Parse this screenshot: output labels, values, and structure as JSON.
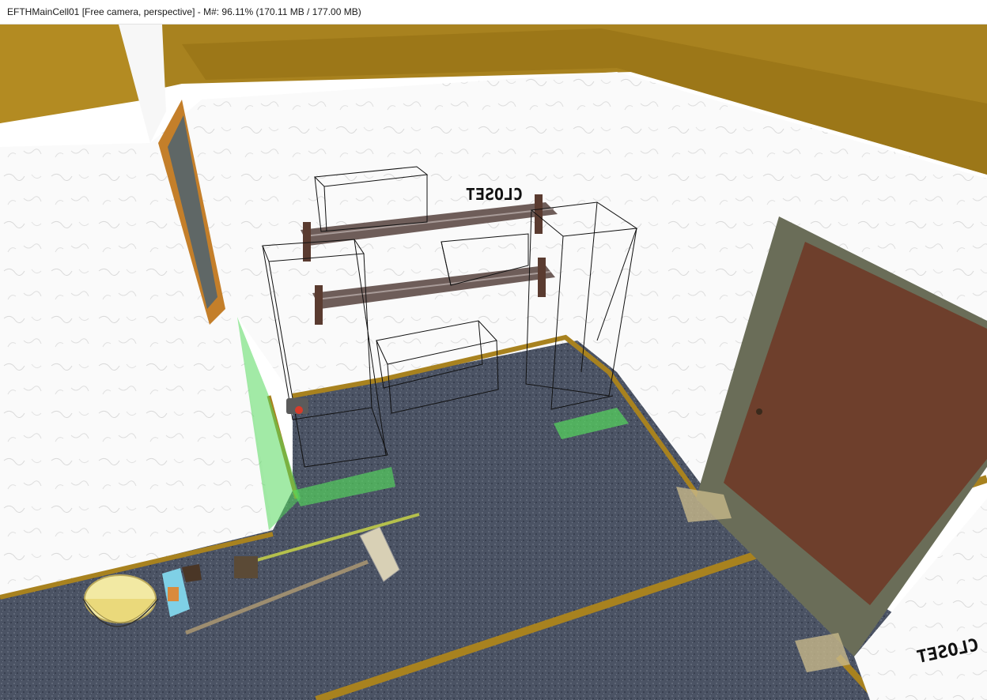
{
  "window": {
    "title": "EFTHMainCell01 [Free camera, perspective] - M#: 96.11% (170.11 MB / 177.00 MB)"
  },
  "viewport": {
    "signs": {
      "closet_back": "CLOSET",
      "closet_right": "CLOSET"
    }
  },
  "colors": {
    "trim": "#a8821f",
    "carpet": "#4a5263",
    "wall": "#fbfbfb",
    "door": "#6e3f2c",
    "door_frame": "#6a6d58",
    "collision_green": "#55d95c",
    "bucket": "#f2e9a3"
  }
}
